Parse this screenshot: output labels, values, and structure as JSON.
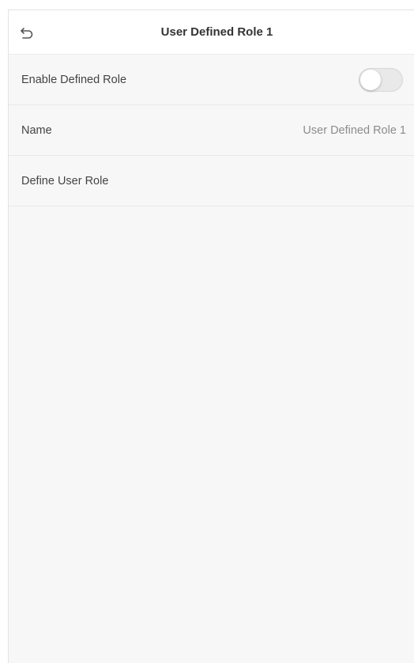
{
  "header": {
    "title": "User Defined Role 1",
    "back_icon": "back-arrow-icon"
  },
  "settings": {
    "enable_role": {
      "label": "Enable Defined Role",
      "toggle_on": false,
      "toggle_color": "#e9e9e9"
    },
    "name": {
      "label": "Name",
      "value": "User Defined Role 1"
    },
    "define_user_role": {
      "label": "Define User Role"
    }
  },
  "colors": {
    "background": "#f7f7f7",
    "header_bg": "#ffffff",
    "text_primary": "#333333",
    "text_secondary": "#8c8c8c"
  }
}
